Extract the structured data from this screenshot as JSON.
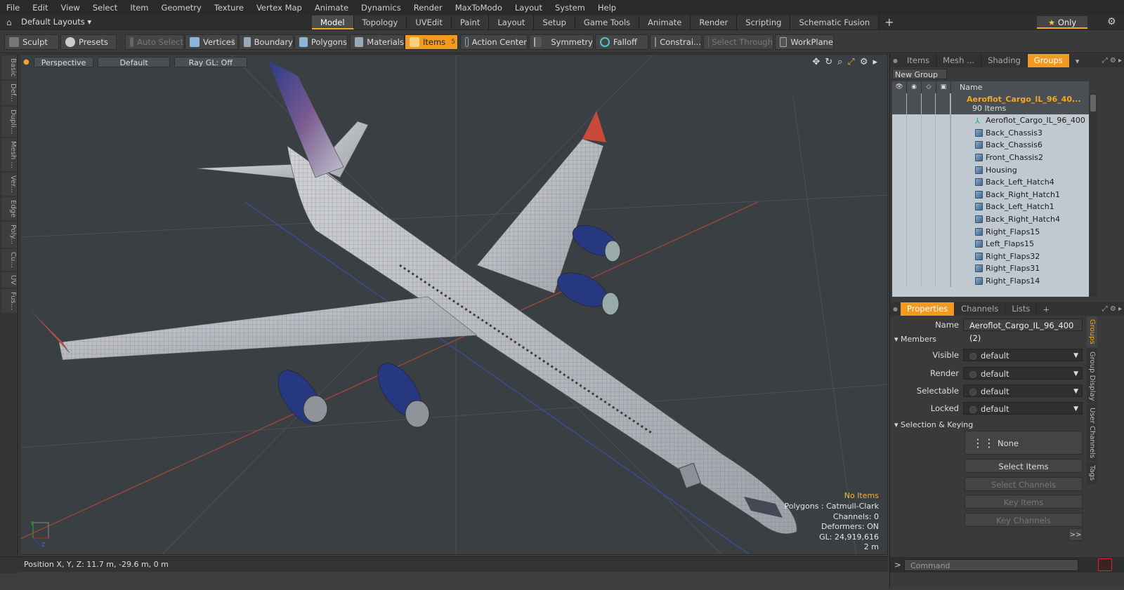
{
  "menu": [
    "File",
    "Edit",
    "View",
    "Select",
    "Item",
    "Geometry",
    "Texture",
    "Vertex Map",
    "Animate",
    "Dynamics",
    "Render",
    "MaxToModo",
    "Layout",
    "System",
    "Help"
  ],
  "layouts_label": "Default Layouts ▾",
  "mode_tabs": [
    "Model",
    "Topology",
    "UVEdit",
    "Paint",
    "Layout",
    "Setup",
    "Game Tools",
    "Animate",
    "Render",
    "Scripting",
    "Schematic Fusion"
  ],
  "active_mode_tab": "Model",
  "only_label": "Only",
  "toolbar": {
    "sculpt": "Sculpt",
    "presets": "Presets",
    "auto_select": "Auto Select",
    "vertices": "Vertices",
    "vertices_count": "1",
    "boundary": "Boundary",
    "polygons": "Polygons",
    "materials": "Materials",
    "items": "Items",
    "items_count": "5",
    "action_center": "Action Center",
    "symmetry": "Symmetry",
    "falloff": "Falloff",
    "constraints": "Constrai...",
    "select_through": "Select Through",
    "workplane": "WorkPlane"
  },
  "left_tabs": [
    "Basic",
    "Def...",
    "Dupli...",
    "Mesh ...",
    "Ver...",
    "Edge",
    "Poly...",
    "Cu...",
    "UV",
    "Fus..."
  ],
  "viewport": {
    "view_label": "Perspective",
    "shading_label": "Default",
    "raygl_label": "Ray GL: Off",
    "stats": {
      "selection": "No Items",
      "polygons": "Polygons : Catmull-Clark",
      "channels": "Channels: 0",
      "deformers": "Deformers: ON",
      "gl": "GL: 24,919,616",
      "scale": "2 m"
    }
  },
  "statusbar": {
    "position": "Position X, Y, Z:   11.7 m, -29.6 m, 0 m"
  },
  "right_tabs": [
    "Items",
    "Mesh ...",
    "Shading",
    "Groups"
  ],
  "active_right_tab": "Groups",
  "new_group": "New Group",
  "tree": {
    "header_name": "Name",
    "group_name": "Aeroflot_Cargo_IL_96_40...",
    "group_count": "90 Items",
    "items": [
      "Aeroflot_Cargo_IL_96_400",
      "Back_Chassis3",
      "Back_Chassis6",
      "Front_Chassis2",
      "Housing",
      "Back_Left_Hatch4",
      "Back_Right_Hatch1",
      "Back_Left_Hatch1",
      "Back_Right_Hatch4",
      "Right_Flaps15",
      "Left_Flaps15",
      "Right_Flaps32",
      "Right_Flaps31",
      "Right_Flaps14"
    ]
  },
  "prop_tabs": [
    "Properties",
    "Channels",
    "Lists"
  ],
  "properties": {
    "name_label": "Name",
    "name_value": "Aeroflot_Cargo_IL_96_400 (2)",
    "members_section": "Members",
    "visible_label": "Visible",
    "visible_value": "default",
    "render_label": "Render",
    "render_value": "default",
    "selectable_label": "Selectable",
    "selectable_value": "default",
    "locked_label": "Locked",
    "locked_value": "default",
    "selection_section": "Selection & Keying",
    "none_label": "None",
    "select_items": "Select Items",
    "select_channels": "Select Channels",
    "key_items": "Key Items",
    "key_channels": "Key Channels",
    "expand": ">>"
  },
  "side_tabs": [
    "Groups",
    "Group Display",
    "User Channels",
    "Tags"
  ],
  "command_placeholder": "Command",
  "colors": {
    "accent": "#f29a1f",
    "fuselage": "#b9bbbf",
    "engine": "#2a3a8a"
  }
}
